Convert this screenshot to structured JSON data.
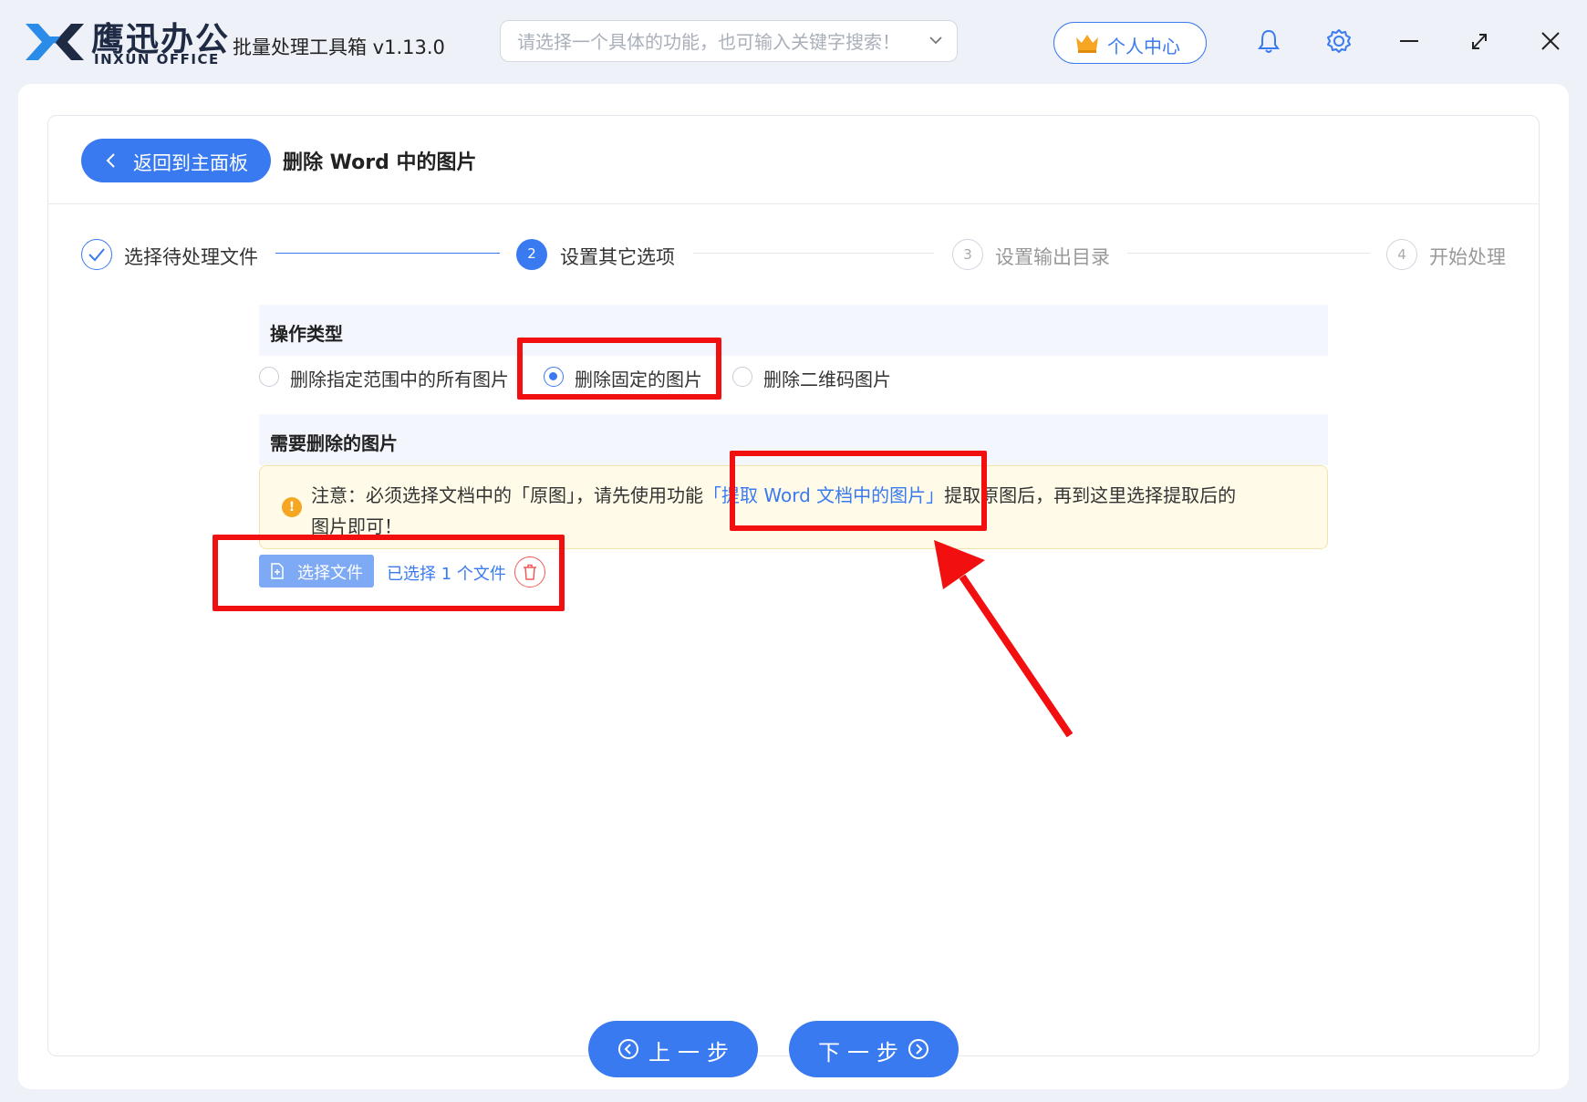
{
  "titlebar": {
    "logo_cn": "鹰迅办公",
    "logo_en": "INXUN OFFICE",
    "app_title": "批量处理工具箱 v1.13.0",
    "search_placeholder": "请选择一个具体的功能，也可输入关键字搜索！",
    "user_center_label": "个人中心",
    "icons": [
      "bell-icon",
      "gear-icon",
      "minimize-icon",
      "maximize-icon",
      "close-icon"
    ]
  },
  "header": {
    "back_label": "返回到主面板",
    "page_title": "删除 Word 中的图片"
  },
  "steps": [
    {
      "number": "✓",
      "label": "选择待处理文件",
      "state": "done"
    },
    {
      "number": "2",
      "label": "设置其它选项",
      "state": "active"
    },
    {
      "number": "3",
      "label": "设置输出目录",
      "state": "pending"
    },
    {
      "number": "4",
      "label": "开始处理",
      "state": "pending"
    }
  ],
  "operation": {
    "heading": "操作类型",
    "options": [
      {
        "label": "删除指定范围中的所有图片",
        "selected": false
      },
      {
        "label": "删除固定的图片",
        "selected": true
      },
      {
        "label": "删除二维码图片",
        "selected": false
      }
    ]
  },
  "images_section": {
    "heading": "需要删除的图片",
    "notice_prefix": "注意：必须选择文档中的「原图」，请先使用功能",
    "notice_link": "「提取 Word 文档中的图片」",
    "notice_suffix": "提取原图后，再到这里选择提取后的",
    "notice_line2": "图片即可！",
    "select_file_label": "选择文件",
    "selected_count_text": "已选择 1 个文件"
  },
  "footer": {
    "prev_label": "上一步",
    "next_label": "下一步"
  },
  "colors": {
    "accent": "#3a7af0",
    "annotation": "#f20f0f",
    "notice_bg": "#fffbe8",
    "warning": "#f5a623"
  }
}
